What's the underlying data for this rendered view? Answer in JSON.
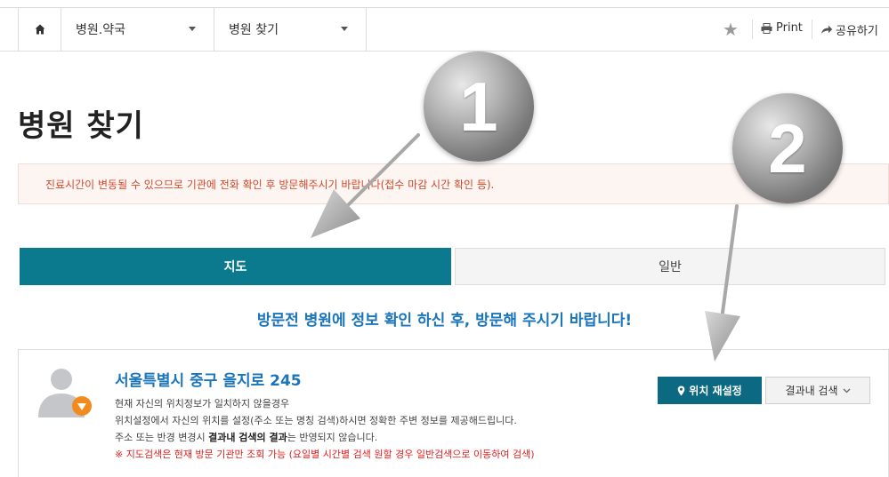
{
  "topbar": {
    "menu1": "병원.약국",
    "menu2": "병원 찾기",
    "print": "Print",
    "share": "공유하기"
  },
  "page_title": "병원 찾기",
  "notice": "진료시간이 변동될 수 있으므로 기관에 전화 확인 후 방문해주시기 바랍니다(접수 마감 시간 확인 등).",
  "tabs": {
    "map": "지도",
    "general": "일반"
  },
  "headline": "방문전 병원에 정보 확인 하신 후, 방문해 주시기 바랍니다!",
  "location": {
    "address": "서울특별시 중구 을지로 245",
    "line1": "현재 자신의 위치정보가 일치하지 않을경우",
    "line2": "위치설정에서 자신의 위치를 설정(주소 또는 명칭 검색)하시면 정확한 주변 정보를 제공해드립니다.",
    "line3_pre": "주소 또는 반경 변경시 ",
    "line3_bold": "결과내 검색의 결과",
    "line3_post": "는 반영되지 않습니다.",
    "line4": "※ 지도검색은 현재 방문 기관만 조회 가능 (요일별 시간별 검색 원할 경우 일반검색으로 이동하여 검색)"
  },
  "buttons": {
    "reset_location": "위치 재설정",
    "search_in_results": "결과내 검색"
  },
  "callouts": {
    "one": "1",
    "two": "2"
  },
  "colors": {
    "accent": "#0b7a8f",
    "headline": "#1a75bb",
    "notice_text": "#d1492b",
    "warning": "#e02020"
  },
  "icons": [
    "home-icon",
    "chevron-down-icon",
    "star-icon",
    "printer-icon",
    "share-arrow-icon",
    "user-avatar-icon",
    "location-pin-icon"
  ]
}
